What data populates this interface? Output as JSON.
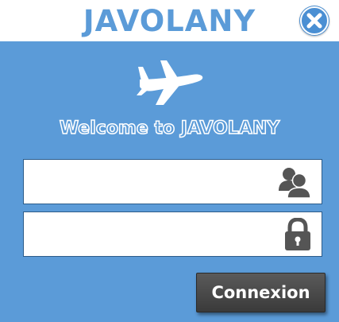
{
  "header": {
    "app_title": "JAVOLANY",
    "close_icon": "close-x-icon"
  },
  "main": {
    "logo_icon": "airplane-icon",
    "welcome_text": "Welcome to JAVOLANY",
    "username_field": {
      "value": "",
      "icon": "users-icon"
    },
    "password_field": {
      "value": "",
      "icon": "lock-icon"
    },
    "login_button_label": "Connexion"
  },
  "colors": {
    "background": "#5b9bd8",
    "header_bg": "#ffffff",
    "button_bg": "#4a4a4a",
    "icon_gray": "#555555"
  }
}
